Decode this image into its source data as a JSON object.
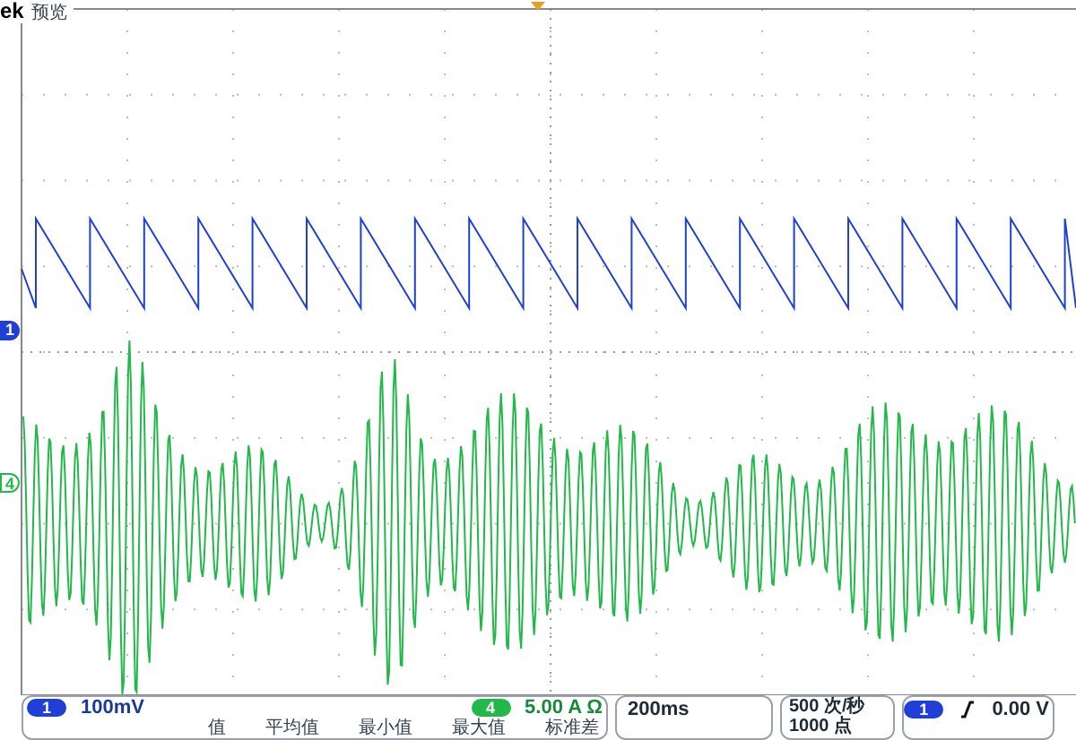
{
  "header": {
    "brand": "ek",
    "mode": "预览"
  },
  "screen_markers": [
    {
      "label": "1",
      "color": "#1f3fd6"
    },
    {
      "label": "4",
      "color": "#22b84a"
    }
  ],
  "channels": [
    {
      "number": "1",
      "scale": "100mV",
      "color": "#1f3fd6"
    },
    {
      "number": "4",
      "scale": "5.00 A Ω",
      "color": "#22b84a"
    }
  ],
  "measurements": {
    "headers": [
      "值",
      "平均值",
      "最小值",
      "最大值",
      "标准差"
    ]
  },
  "timebase": "200ms",
  "acquisition": {
    "rate": "500 次/秒",
    "record": "1000 点"
  },
  "trigger": {
    "source": "1",
    "level": "0.00 V",
    "color": "#1f3fd6"
  }
}
